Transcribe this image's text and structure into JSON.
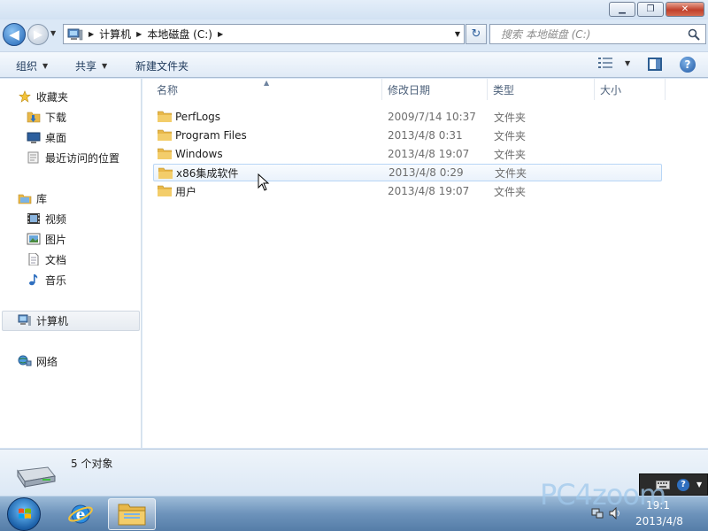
{
  "window": {
    "controls": {
      "minimize": "▁",
      "maximize": "❐",
      "close": "✕"
    }
  },
  "nav": {
    "back_glyph": "◀",
    "forward_glyph": "▶",
    "history_glyph": "▼",
    "breadcrumbs": [
      "计算机",
      "本地磁盘 (C:)"
    ],
    "crumb_sep": "▶",
    "address_dropdown": "▼",
    "refresh_glyph": "↻",
    "search_placeholder": "搜索 本地磁盘 (C:)"
  },
  "toolbar": {
    "organize_label": "组织",
    "share_label": "共享",
    "new_folder_label": "新建文件夹",
    "dropdown_glyph": "▼",
    "help_glyph": "?"
  },
  "sidebar": {
    "favorites_label": "收藏夹",
    "favorites": [
      "下载",
      "桌面",
      "最近访问的位置"
    ],
    "libraries_label": "库",
    "libraries": [
      "视频",
      "图片",
      "文档",
      "音乐"
    ],
    "computer_label": "计算机",
    "network_label": "网络"
  },
  "table": {
    "columns": [
      "名称",
      "修改日期",
      "类型",
      "大小"
    ],
    "sort_glyph": "▲",
    "rows": [
      {
        "name": "PerfLogs",
        "date": "2009/7/14 10:37",
        "type": "文件夹"
      },
      {
        "name": "Program Files",
        "date": "2013/4/8 0:31",
        "type": "文件夹"
      },
      {
        "name": "Windows",
        "date": "2013/4/8 19:07",
        "type": "文件夹"
      },
      {
        "name": "x86集成软件",
        "date": "2013/4/8 0:29",
        "type": "文件夹"
      },
      {
        "name": "用户",
        "date": "2013/4/8 19:07",
        "type": "文件夹"
      }
    ],
    "hovered_row_index": 3
  },
  "details": {
    "count_text": "5 个对象"
  },
  "taskbar": {
    "clock_time": "19:1",
    "clock_date": "2013/4/8"
  },
  "watermark": "PC4zoom",
  "colors": {
    "accent": "#1f63b4",
    "folder": "#e8b84a",
    "hover_border": "#b8d6f6"
  }
}
